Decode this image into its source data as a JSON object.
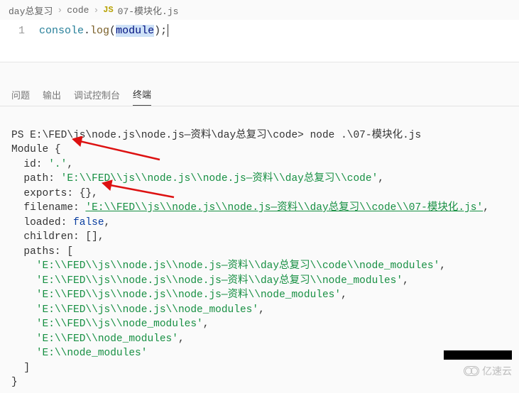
{
  "breadcrumb": {
    "seg1": "day总复习",
    "seg2": "code",
    "js_badge": "JS",
    "seg3": "07-模块化.js"
  },
  "editor": {
    "line_num": "1",
    "tok_obj": "console",
    "dot": ".",
    "tok_fn": "log",
    "lp": "(",
    "tok_hl": "module",
    "rp": ");"
  },
  "tabs": {
    "problems": "问题",
    "output": "输出",
    "debug": "调试控制台",
    "terminal": "终端"
  },
  "term": {
    "prompt": "PS E:\\FED\\js\\node.js\\node.js—资料\\day总复习\\code> ",
    "cmd": "node .\\07-模块化.js",
    "l_mod": "Module {",
    "l_id_k": "  id: ",
    "l_id_v": "'.'",
    "comma": ",",
    "l_path_k": "  path: ",
    "l_path_v": "'E:\\\\FED\\\\js\\\\node.js\\\\node.js—资料\\\\day总复习\\\\code'",
    "l_exp": "  exports: {},",
    "l_fn_k": "  filename: ",
    "l_fn_v": "'E:\\\\FED\\\\js\\\\node.js\\\\node.js—资料\\\\day总复习\\\\code\\\\07-模块化.js'",
    "l_loaded_k": "  loaded: ",
    "l_loaded_v": "false",
    "l_children": "  children: [],",
    "l_paths": "  paths: [",
    "p1": "'E:\\\\FED\\\\js\\\\node.js\\\\node.js—资料\\\\day总复习\\\\code\\\\node_modules'",
    "p2": "'E:\\\\FED\\\\js\\\\node.js\\\\node.js—资料\\\\day总复习\\\\node_modules'",
    "p3": "'E:\\\\FED\\\\js\\\\node.js\\\\node.js—资料\\\\node_modules'",
    "p4": "'E:\\\\FED\\\\js\\\\node.js\\\\node_modules'",
    "p5": "'E:\\\\FED\\\\js\\\\node_modules'",
    "p6": "'E:\\\\FED\\\\node_modules'",
    "p7": "'E:\\\\node_modules'",
    "indent4": "    ",
    "close_arr": "  ]",
    "close_obj": "}"
  },
  "watermark": "亿速云"
}
